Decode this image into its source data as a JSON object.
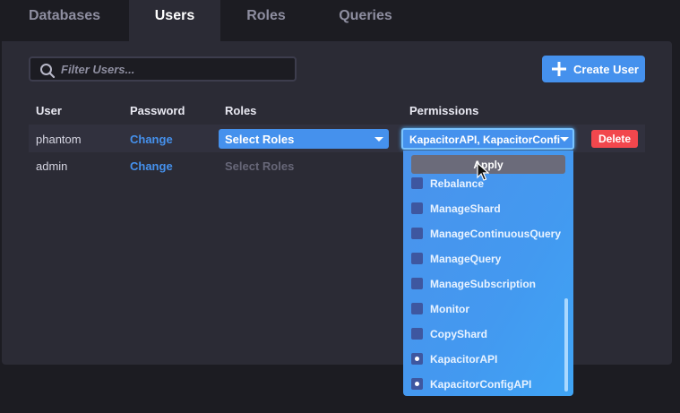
{
  "tabs": [
    {
      "label": "Databases",
      "active": false
    },
    {
      "label": "Users",
      "active": true
    },
    {
      "label": "Roles",
      "active": false
    },
    {
      "label": "Queries",
      "active": false
    }
  ],
  "search": {
    "placeholder": "Filter Users...",
    "value": ""
  },
  "create_user_label": "Create User",
  "table": {
    "headers": [
      "User",
      "Password",
      "Roles",
      "Permissions"
    ],
    "rows": [
      {
        "user": "phantom",
        "password_action": "Change",
        "roles": "Select Roles",
        "permissions": "KapacitorAPI, KapacitorConfigAPI",
        "delete_label": "Delete"
      },
      {
        "user": "admin",
        "password_action": "Change",
        "roles": "Select Roles"
      }
    ]
  },
  "permissions_menu": {
    "apply_label": "Apply",
    "options": [
      {
        "label": "Rebalance",
        "checked": false
      },
      {
        "label": "ManageShard",
        "checked": false
      },
      {
        "label": "ManageContinuousQuery",
        "checked": false
      },
      {
        "label": "ManageQuery",
        "checked": false
      },
      {
        "label": "ManageSubscription",
        "checked": false
      },
      {
        "label": "Monitor",
        "checked": false
      },
      {
        "label": "CopyShard",
        "checked": false
      },
      {
        "label": "KapacitorAPI",
        "checked": true
      },
      {
        "label": "KapacitorConfigAPI",
        "checked": true
      }
    ]
  },
  "colors": {
    "accent": "#4591ed",
    "danger": "#f2474d",
    "background": "#1c1c22",
    "panel": "#2b2b35"
  },
  "icons": [
    "search-icon",
    "plus-icon",
    "caret-down-icon",
    "checkbox-icon",
    "mouse-cursor-icon"
  ]
}
